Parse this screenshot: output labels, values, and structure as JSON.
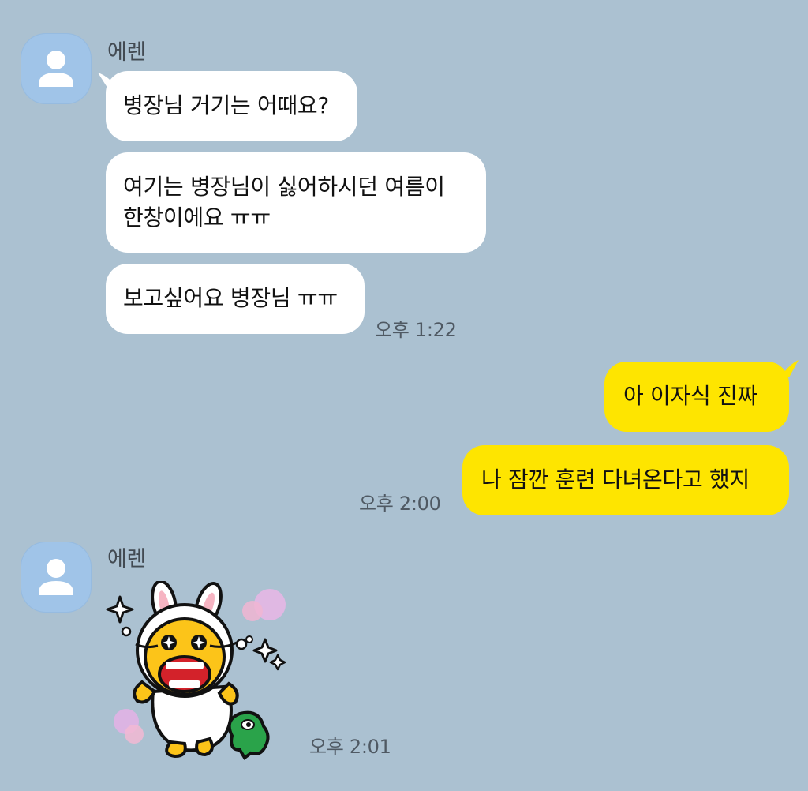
{
  "colors": {
    "background": "#abc1d1",
    "incoming_bubble": "#ffffff",
    "outgoing_bubble": "#fee500",
    "avatar": "#a0c4e8"
  },
  "group1": {
    "sender": "에렌",
    "avatar_icon": "person-icon",
    "messages": [
      "병장님 거기는 어때요?",
      "여기는 병장님이 싫어하시던 여름이",
      "한창이에요 ㅠㅠ",
      "보고싶어요 병장님 ㅠㅠ"
    ],
    "time": "오후 1:22"
  },
  "group2": {
    "messages": [
      "아 이자식 진짜",
      "나 잠깐 훈련 다녀온다고 했지"
    ],
    "time": "오후 2:00"
  },
  "group3": {
    "sender": "에렌",
    "avatar_icon": "person-icon",
    "sticker": "crying-rabbit-sticker",
    "time": "오후 2:01"
  }
}
